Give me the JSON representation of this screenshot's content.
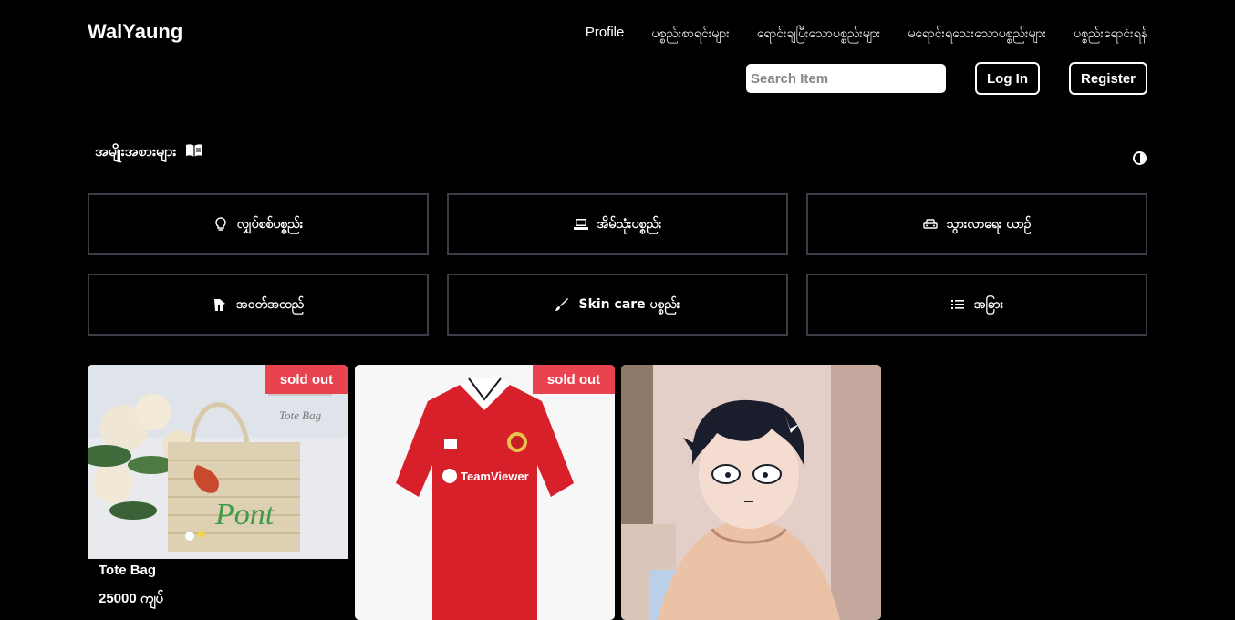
{
  "nav": {
    "brand": "WalYaung",
    "links": [
      "Profile",
      "ပစ္စည်းစာရင်းများ",
      "ရောင်းချပြီးသောပစ္စည်းများ",
      "မရောင်းရသေးသောပစ္စည်းများ",
      "ပစ္စည်းရောင်းရန်"
    ]
  },
  "search": {
    "placeholder": "Search Item"
  },
  "auth": {
    "login_label": "Log In",
    "register_label": "Register"
  },
  "categories_section": {
    "title": "အမျိုးအစားများ",
    "title_icon": "book-icon",
    "toggle_icon": "contrast-icon"
  },
  "categories": [
    {
      "label": "လျှပ်စစ်ပစ္စည်း",
      "icon": "lightbulb-icon"
    },
    {
      "label": "အိမ်သုံးပစ္စည်း",
      "icon": "laptop-icon"
    },
    {
      "label": "သွားလာရေး ယာဉ်",
      "icon": "car-icon"
    },
    {
      "label": "အဝတ်အထည်",
      "icon": "hanger-icon"
    },
    {
      "label": "Skin care ပစ္စည်း",
      "icon": "brush-icon"
    },
    {
      "label": "အခြား",
      "icon": "list-icon"
    }
  ],
  "products": [
    {
      "name": "Tote Bag",
      "price": "25000 ကျပ်",
      "badge": "sold out",
      "image": "tote-bag-photo"
    },
    {
      "name": "",
      "price": "",
      "badge": "sold out",
      "image": "red-jersey-photo"
    },
    {
      "name": "",
      "price": "",
      "badge": "",
      "image": "anime-boy-photo"
    }
  ],
  "colors": {
    "badge": "#e8434f",
    "background": "#000000",
    "border": "#3a3e46"
  }
}
